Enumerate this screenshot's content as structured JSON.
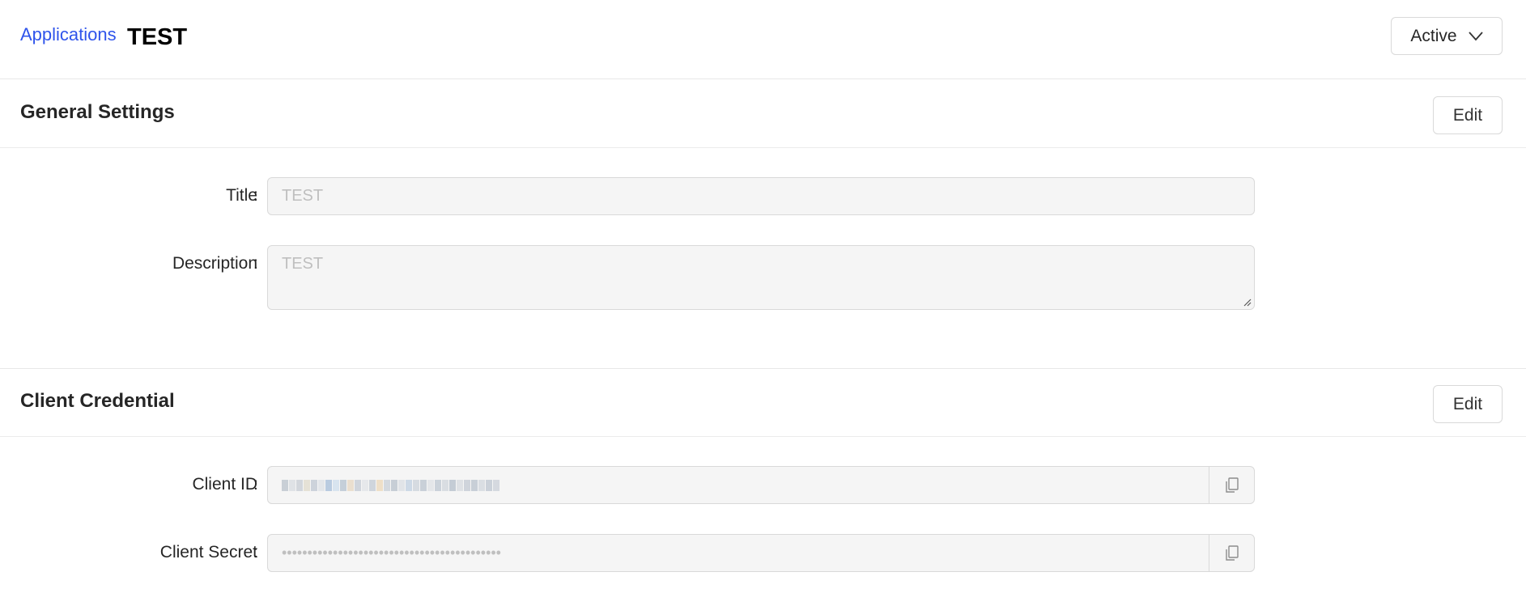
{
  "header": {
    "breadcrumb_link": "Applications",
    "title": "TEST",
    "status_value": "Active"
  },
  "general_settings": {
    "heading": "General Settings",
    "edit_label": "Edit",
    "title_label": "Title",
    "title_value": "TEST",
    "description_label": "Description",
    "description_value": "TEST"
  },
  "client_credential": {
    "heading": "Client Credential",
    "edit_label": "Edit",
    "client_id_label": "Client ID",
    "client_secret_label": "Client Secret",
    "client_secret_value": "•••••••••••••••••••••••••••••••••••••••••••"
  },
  "icons": {
    "status_dropdown": "chevron-down-icon",
    "copy": "copy-icon",
    "resize": "resize-handle-icon"
  },
  "colors": {
    "link": "#2f54eb",
    "field_bg": "#f5f5f5",
    "border": "#d9d9d9"
  }
}
